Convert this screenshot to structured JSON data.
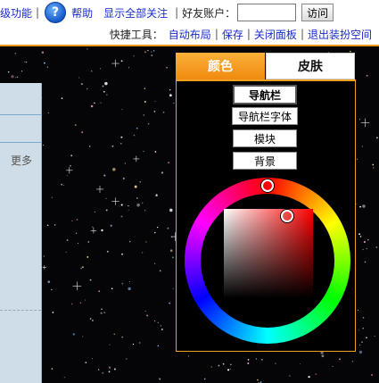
{
  "topbar": {
    "upgrade_link": "级功能",
    "sep": "|",
    "help": "帮助",
    "show_all": "显示全部关注",
    "friend_label": "好友账户：",
    "friend_value": "",
    "visit_button": "访问",
    "quick_tools_label": "快捷工具：",
    "tools": [
      "自动布局",
      "保存",
      "关闭面板",
      "退出装扮空间"
    ]
  },
  "side": {
    "more": "更多"
  },
  "panel": {
    "tabs": [
      "颜色",
      "皮肤"
    ],
    "active_tab": "颜色",
    "options": [
      "导航栏",
      "导航栏字体",
      "模块",
      "背景"
    ],
    "selected_option": "导航栏"
  },
  "colors": {
    "accent": "#f29a1a",
    "link": "#1a2cc8"
  }
}
